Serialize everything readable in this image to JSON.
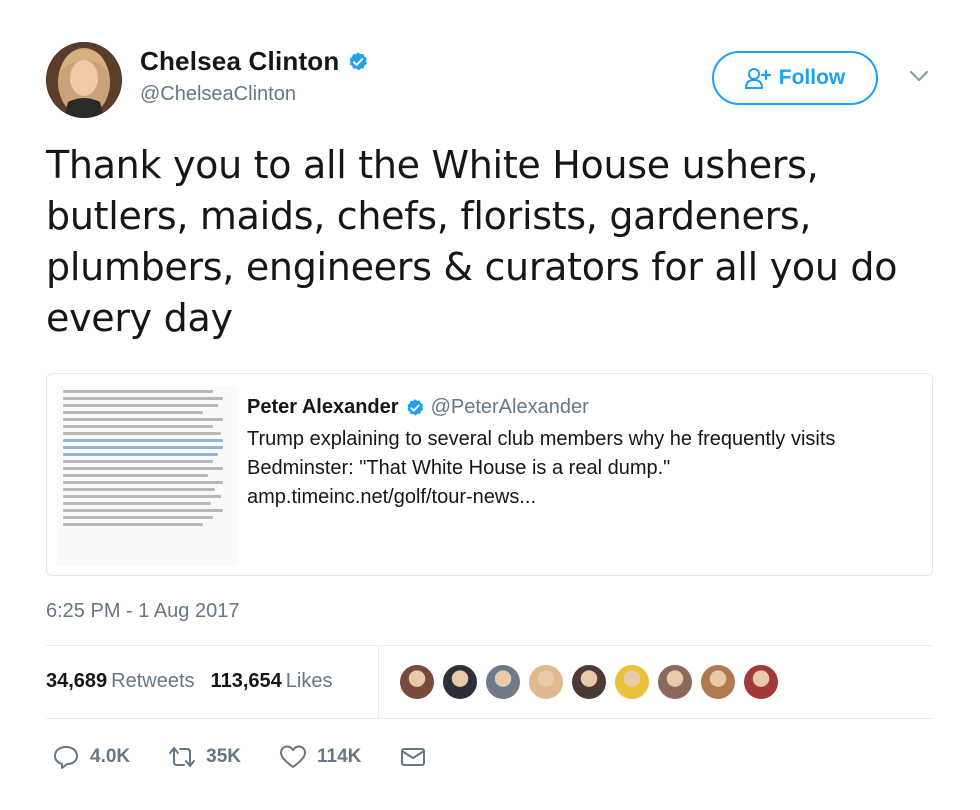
{
  "author": {
    "display_name": "Chelsea Clinton",
    "handle": "@ChelseaClinton",
    "verified": true,
    "follow_label": "Follow"
  },
  "tweet": {
    "text": "Thank you to all the White House ushers, butlers, maids, chefs, florists, gardeners, plumbers, engineers & curators for all you do every day",
    "timestamp": "6:25 PM - 1 Aug 2017"
  },
  "quoted_tweet": {
    "display_name": "Peter Alexander",
    "handle": "@PeterAlexander",
    "verified": true,
    "text": "Trump explaining to several club members why he frequently visits Bedminster: \"That White House is a real dump.\"",
    "link": "amp.timeinc.net/golf/tour-news..."
  },
  "stats": {
    "retweets_count": "34,689",
    "retweets_label": "Retweets",
    "likes_count": "113,654",
    "likes_label": "Likes"
  },
  "liker_avatars": [
    "#7a4a3a",
    "#2b2f3a",
    "#6f7b88",
    "#e0b98f",
    "#4b3a33",
    "#e8c23a",
    "#8a6a5c",
    "#b07a4e",
    "#a33a3a"
  ],
  "actions": {
    "reply_count": "4.0K",
    "retweet_count": "35K",
    "like_count": "114K"
  },
  "colors": {
    "accent": "#1da1f2",
    "secondary_text": "#657786",
    "border": "#e1e8ed"
  }
}
